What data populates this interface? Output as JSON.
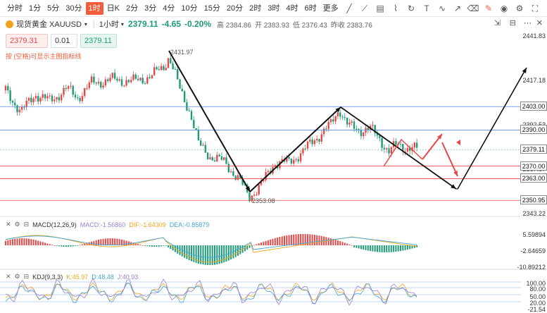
{
  "toolbar": {
    "timeframes": [
      "分时",
      "1分",
      "5分",
      "30分",
      "1时",
      "日K",
      "2分",
      "3分",
      "4分",
      "10分",
      "15分",
      "20分",
      "2时",
      "3时",
      "4时",
      "6时",
      "更多"
    ],
    "active": "1时"
  },
  "symbol": {
    "name": "现货黄金 XAUUSD",
    "period": "1小时",
    "price": "2379.11",
    "change": "-4.65",
    "change_pct": "-0.20%",
    "high": "高 2384.86",
    "open": "开 2383.93",
    "low": "低 2376.43",
    "prev_close": "昨收 2383.76"
  },
  "inputs": {
    "sell": "2379.31",
    "spread": "0.01",
    "buy": "2379.11"
  },
  "hint": "按 (空格)可显示主图指标线",
  "annotations": {
    "high_label": "2431.97",
    "low_label": "2353.08"
  },
  "price_axis": {
    "labels": [
      {
        "text": "2441.83",
        "value": 2441.83
      },
      {
        "text": "2417.18",
        "value": 2417.18
      },
      {
        "text": "2392.53",
        "value": 2392.53
      },
      {
        "text": "2367.87",
        "value": 2367.87
      },
      {
        "text": "2343.22",
        "value": 2343.22
      }
    ],
    "tags": [
      {
        "text": "2403.00",
        "value": 2403.0
      },
      {
        "text": "2390.00",
        "value": 2390.0
      },
      {
        "text": "2379.11",
        "value": 2379.11
      },
      {
        "text": "2370.00",
        "value": 2370.0
      },
      {
        "text": "2363.00",
        "value": 2363.0
      },
      {
        "text": "2350.95",
        "value": 2350.95
      }
    ]
  },
  "macd": {
    "title": "MACD(12,26,9)",
    "macd": "MACD:-1.56860",
    "dif": "DIF:-1.64309",
    "dea": "DEA:-0.85879",
    "axis": [
      "5.59894",
      "-2.64659",
      "-10.89212"
    ]
  },
  "kdj": {
    "title": "KDJ(9,3,3)",
    "k": "K:45.97",
    "d": "D:48.48",
    "j": "J:40.93",
    "axis": [
      "100.00",
      "80.00",
      "50.00",
      "20.00",
      "-21.54"
    ]
  },
  "colors": {
    "up": "#e54848",
    "down": "#1e9b78",
    "accent": "#f25c3a",
    "blue_line": "#5b8bd6"
  }
}
